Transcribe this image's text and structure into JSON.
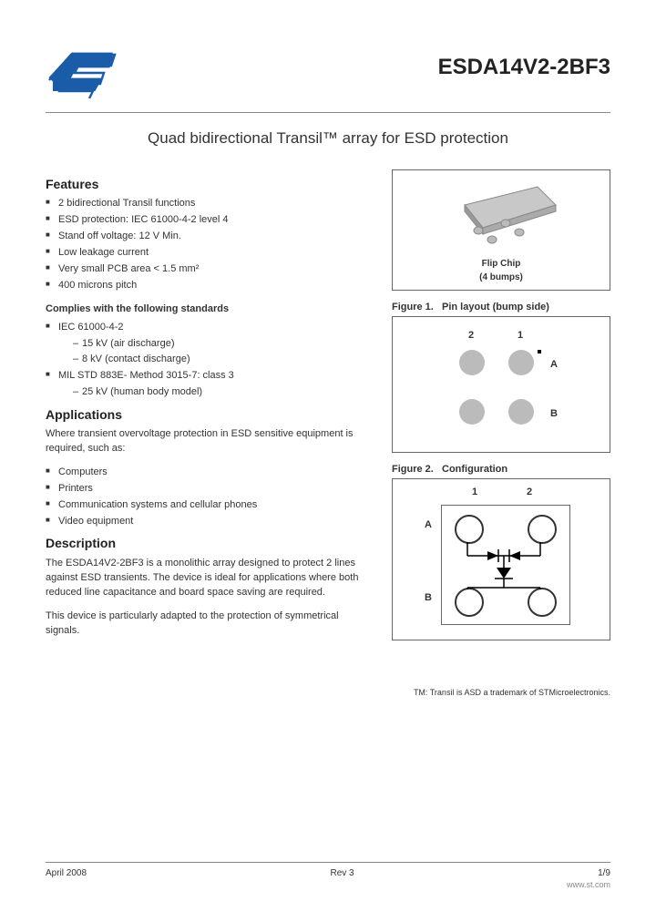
{
  "header": {
    "part_number": "ESDA14V2-2BF3",
    "subtitle": "Quad bidirectional Transil™ array for ESD protection"
  },
  "features": {
    "heading": "Features",
    "items": [
      "2 bidirectional Transil functions",
      "ESD protection: IEC 61000-4-2 level 4",
      "Stand off voltage: 12 V Min.",
      "Low leakage current",
      "Very small PCB area < 1.5 mm²",
      "400 microns pitch"
    ],
    "complies_heading": "Complies with the following standards",
    "complies": [
      {
        "label": "IEC 61000-4-2",
        "sub": [
          "15 kV (air discharge)",
          "8 kV (contact discharge)"
        ]
      },
      {
        "label": "MIL STD 883E- Method 3015-7: class 3",
        "sub": [
          "25 kV (human body model)"
        ]
      }
    ]
  },
  "applications": {
    "heading": "Applications",
    "intro": "Where transient overvoltage protection in ESD sensitive equipment is required, such as:",
    "items": [
      "Computers",
      "Printers",
      "Communication systems and cellular phones",
      "Video equipment"
    ]
  },
  "description": {
    "heading": "Description",
    "p1": "The ESDA14V2-2BF3 is a monolithic array designed to protect 2 lines against ESD transients. The device is ideal for applications where both reduced line capacitance and board space saving are required.",
    "p2": "This device is particularly adapted to the protection of symmetrical signals."
  },
  "figures": {
    "package_caption1": "Flip Chip",
    "package_caption2": "(4 bumps)",
    "fig1_label": "Figure 1.",
    "fig1_title": "Pin layout (bump side)",
    "fig2_label": "Figure 2.",
    "fig2_title": "Configuration",
    "col1": "1",
    "col2": "2",
    "rowA": "A",
    "rowB": "B"
  },
  "tm_note": "TM: Transil is ASD a trademark of STMicroelectronics.",
  "footer": {
    "date": "April 2008",
    "rev": "Rev 3",
    "page": "1/9",
    "url": "www.st.com"
  }
}
